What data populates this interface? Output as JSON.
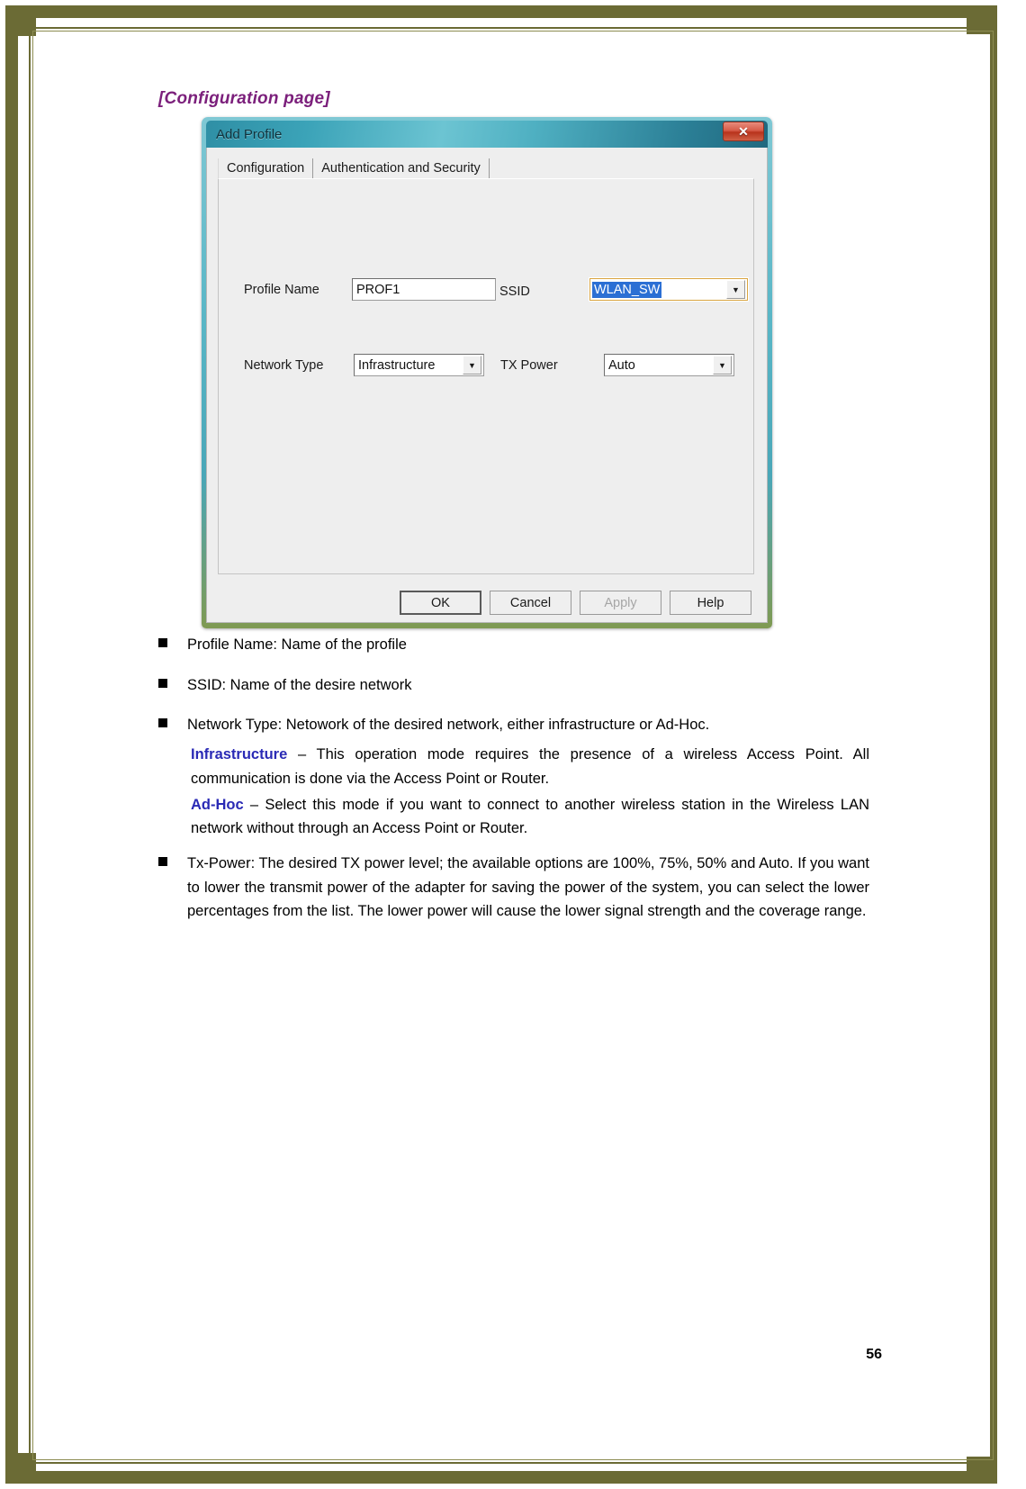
{
  "page": {
    "heading": "[Configuration page]",
    "number": "56"
  },
  "dialog": {
    "title": "Add Profile",
    "close_label": "✕",
    "tabs": [
      {
        "label": "Configuration",
        "selected": true
      },
      {
        "label": "Authentication and Security",
        "selected": false
      }
    ],
    "fields": {
      "profile_name_label": "Profile Name",
      "profile_name_value": "PROF1",
      "ssid_label": "SSID",
      "ssid_value": "WLAN_SW",
      "network_type_label": "Network Type",
      "network_type_value": "Infrastructure",
      "tx_power_label": "TX Power",
      "tx_power_value": "Auto"
    },
    "buttons": {
      "ok": "OK",
      "cancel": "Cancel",
      "apply": "Apply",
      "help": "Help"
    }
  },
  "content": {
    "bullet1": "Profile Name: Name of the profile",
    "bullet2": "SSID: Name of the desire network",
    "bullet3": "Network Type: Netowork of the desired network, either infrastructure or Ad-Hoc.",
    "infra_keyword": "Infrastructure",
    "infra_text": " – This operation mode requires the presence of a wireless Access Point. All communication is done via the Access Point or Router.",
    "adhoc_keyword": "Ad-Hoc",
    "adhoc_text": " – Select this mode if you want to connect to another wireless station in the Wireless LAN network without through an Access Point or Router.",
    "bullet4": "Tx-Power: The desired TX power level; the available options are 100%, 75%, 50% and Auto. If you want to lower the transmit power of the adapter for saving the power of the system, you can select the lower percentages from the list. The lower power will cause the lower signal strength and the coverage range."
  },
  "colors": {
    "frame": "#6b6b35",
    "heading": "#7b1f7b",
    "keyword": "#2a2ab5",
    "title_bar": "#4aa7b8",
    "close_button": "#b8321c",
    "selection": "#2b6fd4"
  }
}
